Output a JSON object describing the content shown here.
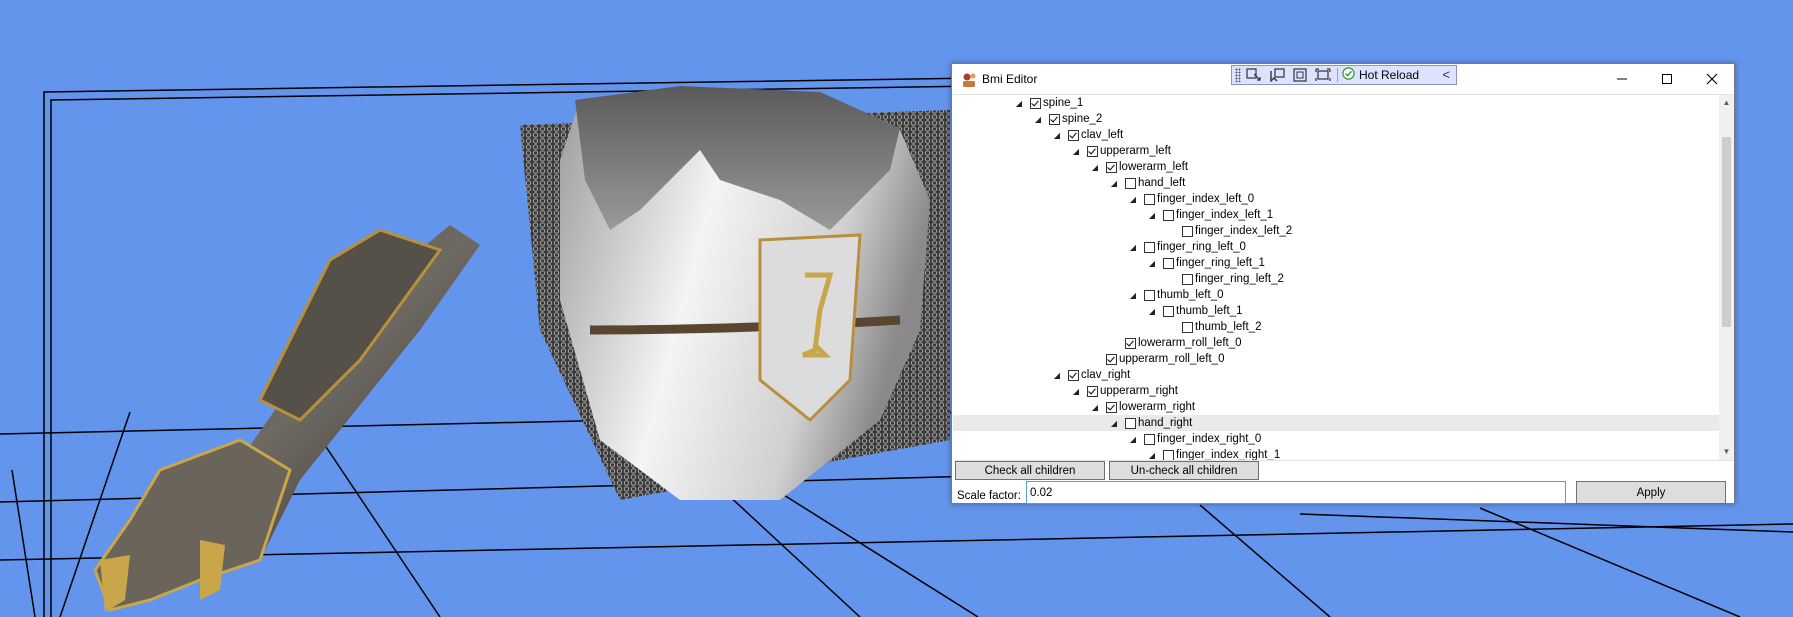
{
  "window": {
    "title": "Bmi Editor",
    "buttons": {
      "minimize": "—",
      "maximize": "☐",
      "close": "✕"
    }
  },
  "debug_toolbar": {
    "icons": [
      "select-element-icon",
      "inspect-cursor-icon",
      "layout-adorner-icon",
      "track-focus-icon"
    ],
    "hot_reload_label": "Hot Reload",
    "collapse_glyph": "<"
  },
  "tree": {
    "nodes": [
      {
        "label": "spine_1",
        "level": 0,
        "checked": true,
        "expandable": true
      },
      {
        "label": "spine_2",
        "level": 1,
        "checked": true,
        "expandable": true
      },
      {
        "label": "clav_left",
        "level": 2,
        "checked": true,
        "expandable": true
      },
      {
        "label": "upperarm_left",
        "level": 3,
        "checked": true,
        "expandable": true
      },
      {
        "label": "lowerarm_left",
        "level": 4,
        "checked": true,
        "expandable": true
      },
      {
        "label": "hand_left",
        "level": 5,
        "checked": false,
        "expandable": true
      },
      {
        "label": "finger_index_left_0",
        "level": 6,
        "checked": false,
        "expandable": true
      },
      {
        "label": "finger_index_left_1",
        "level": 7,
        "checked": false,
        "expandable": true
      },
      {
        "label": "finger_index_left_2",
        "level": 8,
        "checked": false,
        "expandable": false
      },
      {
        "label": "finger_ring_left_0",
        "level": 6,
        "checked": false,
        "expandable": true
      },
      {
        "label": "finger_ring_left_1",
        "level": 7,
        "checked": false,
        "expandable": true
      },
      {
        "label": "finger_ring_left_2",
        "level": 8,
        "checked": false,
        "expandable": false
      },
      {
        "label": "thumb_left_0",
        "level": 6,
        "checked": false,
        "expandable": true
      },
      {
        "label": "thumb_left_1",
        "level": 7,
        "checked": false,
        "expandable": true
      },
      {
        "label": "thumb_left_2",
        "level": 8,
        "checked": false,
        "expandable": false
      },
      {
        "label": "lowerarm_roll_left_0",
        "level": 5,
        "checked": true,
        "expandable": false
      },
      {
        "label": "upperarm_roll_left_0",
        "level": 4,
        "checked": true,
        "expandable": false
      },
      {
        "label": "clav_right",
        "level": 2,
        "checked": true,
        "expandable": true
      },
      {
        "label": "upperarm_right",
        "level": 3,
        "checked": true,
        "expandable": true
      },
      {
        "label": "lowerarm_right",
        "level": 4,
        "checked": true,
        "expandable": true
      },
      {
        "label": "hand_right",
        "level": 5,
        "checked": false,
        "expandable": true,
        "highlighted": true
      },
      {
        "label": "finger_index_right_0",
        "level": 6,
        "checked": false,
        "expandable": true
      },
      {
        "label": "finger_index_right_1",
        "level": 7,
        "checked": false,
        "expandable": true
      }
    ],
    "expander_glyph": "◢"
  },
  "buttons": {
    "check_all": "Check all children",
    "uncheck_all": "Un-check all children",
    "apply": "Apply"
  },
  "scale": {
    "label": "Scale factor:",
    "value": "0.02"
  },
  "colors": {
    "background": "#6495ed",
    "grid_lines": "#000000",
    "toolbar_bg": "#dde3ff",
    "input_focus_border": "#569de5",
    "hot_reload_check": "#2e9b2e"
  }
}
